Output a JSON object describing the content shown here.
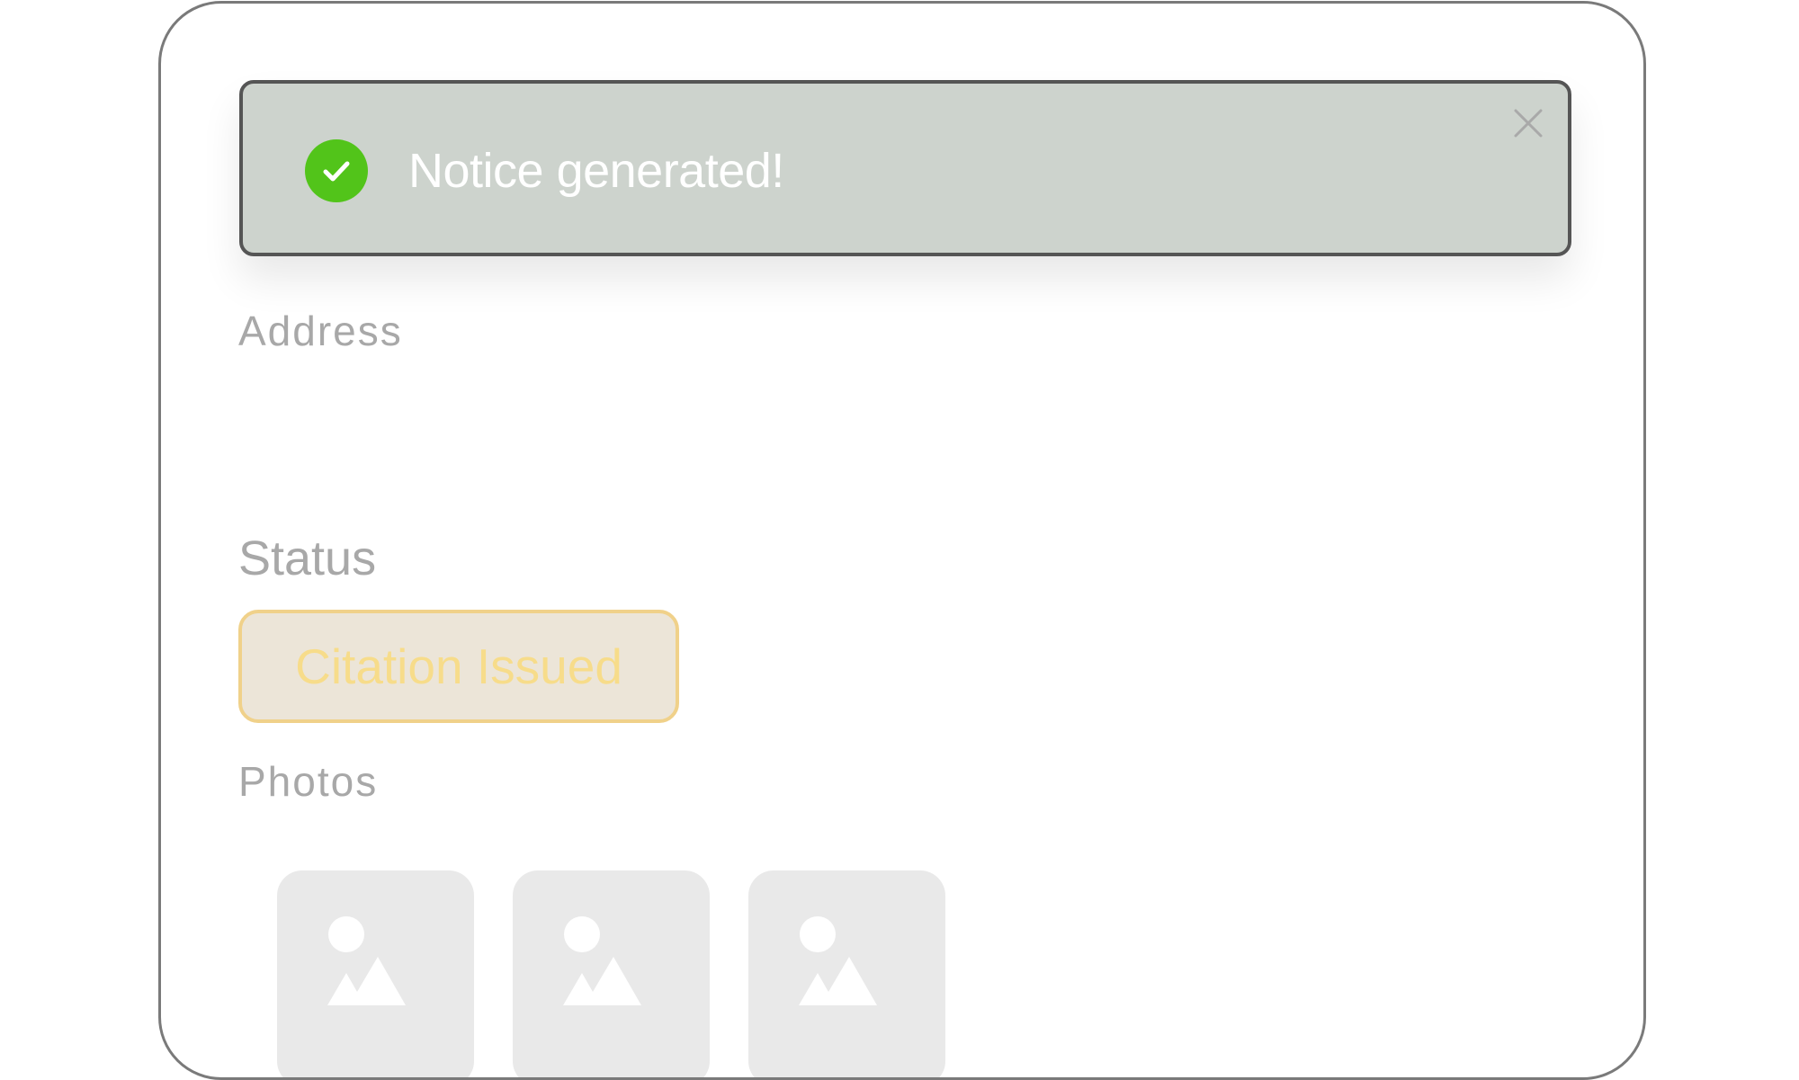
{
  "toast": {
    "message": "Notice generated!",
    "status_icon": "check-circle-icon",
    "close_icon": "close-icon",
    "accent_color": "#52c41a"
  },
  "fields": {
    "address_label": "Address",
    "status_label": "Status",
    "status_value": "Citation Issued",
    "photos_label": "Photos"
  },
  "photos": [
    {
      "icon": "image-placeholder-icon"
    },
    {
      "icon": "image-placeholder-icon"
    },
    {
      "icon": "image-placeholder-icon"
    }
  ]
}
